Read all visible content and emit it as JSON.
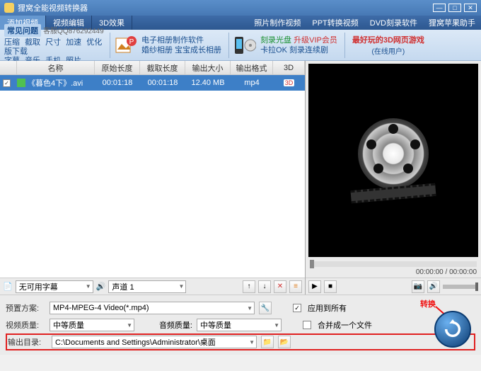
{
  "title": "狸窝全能视频转换器",
  "tabs": [
    "添加视频",
    "视频编辑",
    "3D效果"
  ],
  "menulinks": [
    "照片制作视频",
    "PPT转换视频",
    "DVD刻录软件",
    "狸窝苹果助手"
  ],
  "faq": {
    "title": "常见问题",
    "contact": "客服QQ876292449",
    "links": [
      "压缩",
      "截取",
      "尺寸",
      "加速",
      "优化版下载",
      "字幕",
      "音乐",
      "手机",
      "照片"
    ]
  },
  "tool1": {
    "line1": "电子相册制作软件",
    "line2": "婚纱相册 宝宝成长相册"
  },
  "tool2": {
    "a": "刻录光盘",
    "b": "升级VIP会员",
    "c": "卡拉OK",
    "d": "刻录连续剧"
  },
  "game": {
    "title": "最好玩的3D网页游戏",
    "sub": "(在线用户)"
  },
  "columns": {
    "name": "名称",
    "origLen": "原始长度",
    "clipLen": "截取长度",
    "size": "输出大小",
    "fmt": "输出格式",
    "td": "3D"
  },
  "row": {
    "name": "《暮色4下》.avi",
    "origLen": "00:01:18",
    "clipLen": "00:01:18",
    "size": "12.40 MB",
    "fmt": "mp4"
  },
  "subs": "无可用字幕",
  "audio": "声道 1",
  "time": "00:00:00 / 00:00:00",
  "preset": {
    "lbl": "预置方案:",
    "val": "MP4-MPEG-4 Video(*.mp4)"
  },
  "vq": {
    "lbl": "视频质量:",
    "val": "中等质量"
  },
  "aq": {
    "lbl": "音频质量:",
    "val": "中等质量"
  },
  "out": {
    "lbl": "输出目录:",
    "val": "C:\\Documents and Settings\\Administrator\\桌面"
  },
  "applyAll": "应用到所有",
  "merge": "合并成一个文件",
  "convertLabel": "转换"
}
